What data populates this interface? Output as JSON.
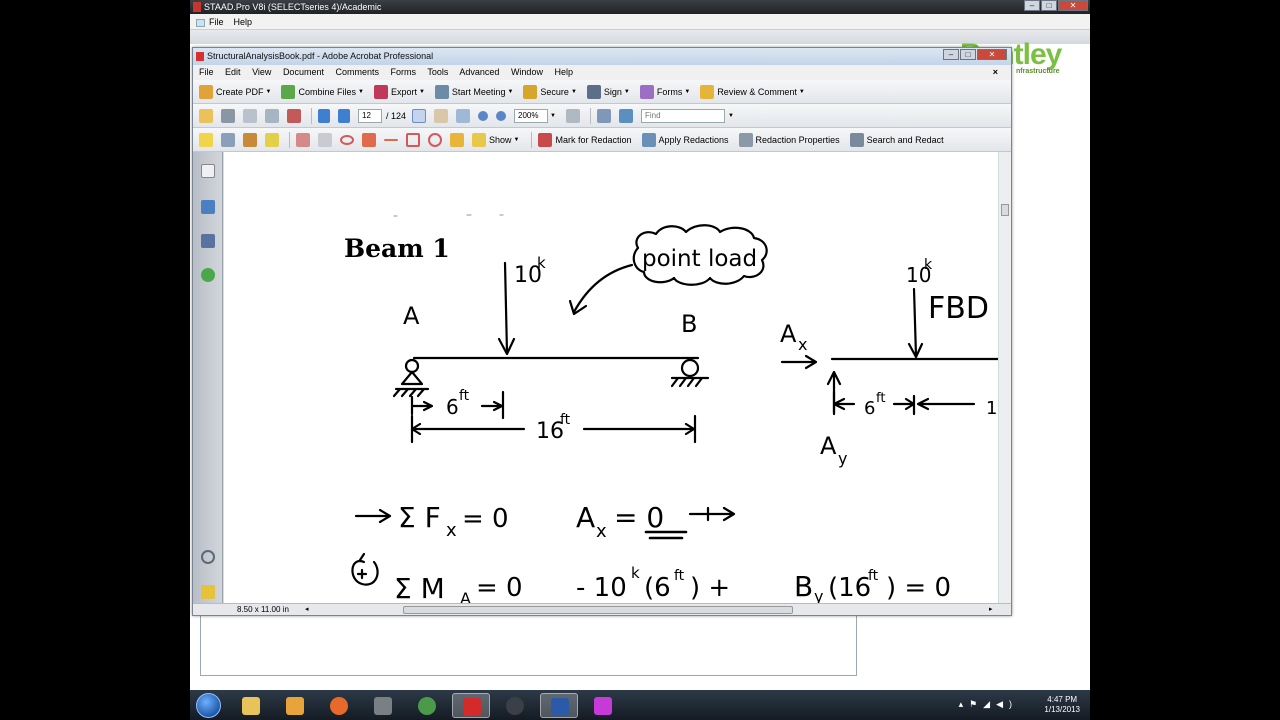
{
  "staad": {
    "title": "STAAD.Pro V8i (SELECTseries 4)/Academic",
    "menu": [
      "File",
      "Help"
    ],
    "brand": "Bentley",
    "brand_sub": "nfrastructure"
  },
  "acrobat": {
    "title": "StructuralAnalysisBook.pdf - Adobe Acrobat Professional",
    "menu": [
      "File",
      "Edit",
      "View",
      "Document",
      "Comments",
      "Forms",
      "Tools",
      "Advanced",
      "Window",
      "Help"
    ],
    "close_glyph": "×",
    "tasks": [
      "Create PDF",
      "Combine Files",
      "Export",
      "Start Meeting",
      "Secure",
      "Sign",
      "Forms",
      "Review & Comment"
    ],
    "page_current": "12",
    "page_total": "/ 124",
    "zoom": "200%",
    "find_placeholder": "Find",
    "redaction": {
      "show": "Show",
      "mark": "Mark for Redaction",
      "apply": "Apply Redactions",
      "props": "Redaction Properties",
      "search": "Search and Redact"
    },
    "page_size": "8.50 x 11.00 in"
  },
  "document": {
    "heading": "Beam 1",
    "handwriting": {
      "load": "10",
      "load_unit": "k",
      "callout": "point load",
      "label_a": "A",
      "label_b": "B",
      "dim_short": "6",
      "dim_long": "16",
      "dim_unit": "ft",
      "fbd": "FBD",
      "ax": "A",
      "ax_sub": "x",
      "ay": "A",
      "ay_sub": "y",
      "dim_fbd": "6",
      "dim_fbd_cut": "1",
      "eq1": "Σ F",
      "eq1_sub": "x",
      "eq1_rhs": "= 0",
      "eq1_result": "A",
      "eq1_result_sub": "x",
      "eq1_result_rhs": "= 0",
      "eq2": "Σ M",
      "eq2_sub": "A",
      "eq2_rhs": "= 0",
      "eq2_term1": "- 10",
      "eq2_term1_sup": "k",
      "eq2_term1_arg": "(6",
      "eq2_term1_close": ") +",
      "eq2_term2": "B",
      "eq2_term2_sub": "y",
      "eq2_term2_arg": "(16",
      "eq2_term2_close": ") = 0"
    }
  },
  "taskbar": {
    "time": "4:47 PM",
    "date": "1/13/2013"
  }
}
